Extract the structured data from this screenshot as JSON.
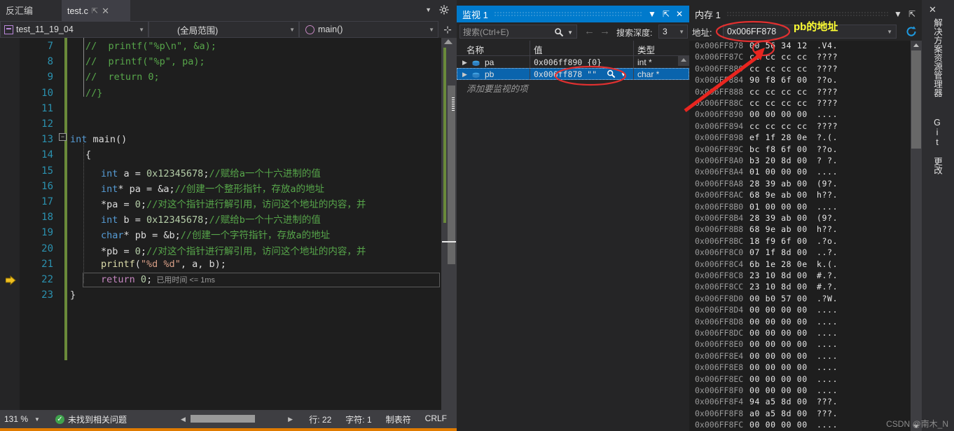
{
  "editor": {
    "tab_inactive_label": "反汇编",
    "tab_active_label": "test.c",
    "tab_pin_icon": "pin-icon",
    "tab_close_icon": "close-icon",
    "nav": {
      "project": "test_11_19_04",
      "scope": "(全局范围)",
      "function": "main()"
    },
    "lines": [
      {
        "n": 7,
        "tokens": [
          {
            "t": "//  printf(\"%p\\n\", &a);",
            "c": "c-cmt"
          }
        ]
      },
      {
        "n": 8,
        "tokens": [
          {
            "t": "//  printf(\"%p\", pa);",
            "c": "c-cmt"
          }
        ]
      },
      {
        "n": 9,
        "tokens": [
          {
            "t": "//  return 0;",
            "c": "c-cmt"
          }
        ]
      },
      {
        "n": 10,
        "tokens": [
          {
            "t": "//}",
            "c": "c-cmt"
          }
        ]
      },
      {
        "n": 11,
        "tokens": []
      },
      {
        "n": 12,
        "tokens": []
      },
      {
        "n": 13,
        "tokens": [
          {
            "t": "int",
            "c": "c-type"
          },
          {
            "t": " ",
            "c": "c-pl"
          },
          {
            "t": "main",
            "c": "c-pl"
          },
          {
            "t": "()",
            "c": "c-pl"
          }
        ]
      },
      {
        "n": 14,
        "tokens": [
          {
            "t": "{",
            "c": "c-pl"
          }
        ]
      },
      {
        "n": 15,
        "tokens": [
          {
            "t": "int",
            "c": "c-type"
          },
          {
            "t": " a = ",
            "c": "c-pl"
          },
          {
            "t": "0x12345678",
            "c": "c-num"
          },
          {
            "t": ";",
            "c": "c-pl"
          },
          {
            "t": "//赋给a一个十六进制的值",
            "c": "c-cmt"
          }
        ]
      },
      {
        "n": 16,
        "tokens": [
          {
            "t": "int",
            "c": "c-type"
          },
          {
            "t": "* pa = &a;",
            "c": "c-pl"
          },
          {
            "t": "//创建一个整形指针，存放a的地址",
            "c": "c-cmt"
          }
        ]
      },
      {
        "n": 17,
        "tokens": [
          {
            "t": "*pa = ",
            "c": "c-pl"
          },
          {
            "t": "0",
            "c": "c-num"
          },
          {
            "t": ";",
            "c": "c-pl"
          },
          {
            "t": "//对这个指针进行解引用，访问这个地址的内容，并",
            "c": "c-cmt"
          }
        ]
      },
      {
        "n": 18,
        "tokens": [
          {
            "t": "int",
            "c": "c-type"
          },
          {
            "t": " b = ",
            "c": "c-pl"
          },
          {
            "t": "0x12345678",
            "c": "c-num"
          },
          {
            "t": ";",
            "c": "c-pl"
          },
          {
            "t": "//赋给b一个十六进制的值",
            "c": "c-cmt"
          }
        ]
      },
      {
        "n": 19,
        "tokens": [
          {
            "t": "char",
            "c": "c-type"
          },
          {
            "t": "* pb = &b;",
            "c": "c-pl"
          },
          {
            "t": "//创建一个字符指针，存放a的地址",
            "c": "c-cmt"
          }
        ]
      },
      {
        "n": 20,
        "tokens": [
          {
            "t": "*pb = ",
            "c": "c-pl"
          },
          {
            "t": "0",
            "c": "c-num"
          },
          {
            "t": ";",
            "c": "c-pl"
          },
          {
            "t": "//对这个指针进行解引用，访问这个地址的内容，并",
            "c": "c-cmt"
          }
        ]
      },
      {
        "n": 21,
        "tokens": [
          {
            "t": "printf",
            "c": "c-fn"
          },
          {
            "t": "(",
            "c": "c-pl"
          },
          {
            "t": "\"%d %d\"",
            "c": "c-str"
          },
          {
            "t": ", a, b);",
            "c": "c-pl"
          }
        ]
      },
      {
        "n": 22,
        "tokens": [
          {
            "t": "return",
            "c": "c-ret"
          },
          {
            "t": " ",
            "c": "c-pl"
          },
          {
            "t": "0",
            "c": "c-num"
          },
          {
            "t": ";",
            "c": "c-pl"
          }
        ]
      },
      {
        "n": 23,
        "tokens": [
          {
            "t": "}",
            "c": "c-pl"
          }
        ]
      }
    ],
    "current_line": 22,
    "elapsed_text": "已用时间 <= 1ms",
    "current_pointer_icon": "execution-pointer-arrow-icon"
  },
  "statusbar": {
    "zoom": "131 %",
    "issues_icon": "check-circle-icon",
    "issues": "未找到相关问题",
    "line_label": "行: 22",
    "char_label": "字符: 1",
    "tabs_label": "制表符",
    "eol_label": "CRLF"
  },
  "watch": {
    "title": "监视 1",
    "dropdown_icon": "chevron-down-icon",
    "pin_icon": "pin-icon",
    "close_icon": "close-icon",
    "search_placeholder": "搜索(Ctrl+E)",
    "search_icon": "magnifier-icon",
    "search_dropdown_icon": "chevron-down-icon",
    "prev_icon": "arrow-left-icon",
    "next_icon": "arrow-right-icon",
    "depth_label": "搜索深度:",
    "depth_value": "3",
    "columns": [
      "名称",
      "值",
      "类型"
    ],
    "rows": [
      {
        "name": "pa",
        "value": "0x006ff890 {0}",
        "type": "int *",
        "selected": false,
        "icon": "variable-icon"
      },
      {
        "name": "pb",
        "value": "0x006ff878 \"\"",
        "type": "char *",
        "selected": true,
        "icon": "variable-icon"
      }
    ],
    "add_item_text": "添加要监视的项"
  },
  "memory": {
    "title": "内存 1",
    "dropdown_icon": "chevron-down-icon",
    "pin_icon": "pin-icon",
    "address_label": "地址:",
    "address_value": "0x006FF878",
    "address_dropdown_icon": "chevron-down-icon",
    "refresh_icon": "refresh-icon",
    "rows": [
      {
        "addr": "0x006FF878",
        "hex": "00 56 34 12",
        "ascii": ".V4."
      },
      {
        "addr": "0x006FF87C",
        "hex": "cc cc cc cc",
        "ascii": "????"
      },
      {
        "addr": "0x006FF880",
        "hex": "cc cc cc cc",
        "ascii": "????"
      },
      {
        "addr": "0x006FF884",
        "hex": "90 f8 6f 00",
        "ascii": "??o."
      },
      {
        "addr": "0x006FF888",
        "hex": "cc cc cc cc",
        "ascii": "????"
      },
      {
        "addr": "0x006FF88C",
        "hex": "cc cc cc cc",
        "ascii": "????"
      },
      {
        "addr": "0x006FF890",
        "hex": "00 00 00 00",
        "ascii": "...."
      },
      {
        "addr": "0x006FF894",
        "hex": "cc cc cc cc",
        "ascii": "????"
      },
      {
        "addr": "0x006FF898",
        "hex": "ef 1f 28 0e",
        "ascii": "?.(."
      },
      {
        "addr": "0x006FF89C",
        "hex": "bc f8 6f 00",
        "ascii": "??o."
      },
      {
        "addr": "0x006FF8A0",
        "hex": "b3 20 8d 00",
        "ascii": "? ?."
      },
      {
        "addr": "0x006FF8A4",
        "hex": "01 00 00 00",
        "ascii": "...."
      },
      {
        "addr": "0x006FF8A8",
        "hex": "28 39 ab 00",
        "ascii": "(9?."
      },
      {
        "addr": "0x006FF8AC",
        "hex": "68 9e ab 00",
        "ascii": "h??."
      },
      {
        "addr": "0x006FF8B0",
        "hex": "01 00 00 00",
        "ascii": "...."
      },
      {
        "addr": "0x006FF8B4",
        "hex": "28 39 ab 00",
        "ascii": "(9?."
      },
      {
        "addr": "0x006FF8B8",
        "hex": "68 9e ab 00",
        "ascii": "h??."
      },
      {
        "addr": "0x006FF8BC",
        "hex": "18 f9 6f 00",
        "ascii": ".?o."
      },
      {
        "addr": "0x006FF8C0",
        "hex": "07 1f 8d 00",
        "ascii": "..?."
      },
      {
        "addr": "0x006FF8C4",
        "hex": "6b 1e 28 0e",
        "ascii": "k.(."
      },
      {
        "addr": "0x006FF8C8",
        "hex": "23 10 8d 00",
        "ascii": "#.?."
      },
      {
        "addr": "0x006FF8CC",
        "hex": "23 10 8d 00",
        "ascii": "#.?."
      },
      {
        "addr": "0x006FF8D0",
        "hex": "00 b0 57 00",
        "ascii": ".?W."
      },
      {
        "addr": "0x006FF8D4",
        "hex": "00 00 00 00",
        "ascii": "...."
      },
      {
        "addr": "0x006FF8D8",
        "hex": "00 00 00 00",
        "ascii": "...."
      },
      {
        "addr": "0x006FF8DC",
        "hex": "00 00 00 00",
        "ascii": "...."
      },
      {
        "addr": "0x006FF8E0",
        "hex": "00 00 00 00",
        "ascii": "...."
      },
      {
        "addr": "0x006FF8E4",
        "hex": "00 00 00 00",
        "ascii": "...."
      },
      {
        "addr": "0x006FF8E8",
        "hex": "00 00 00 00",
        "ascii": "...."
      },
      {
        "addr": "0x006FF8EC",
        "hex": "00 00 00 00",
        "ascii": "...."
      },
      {
        "addr": "0x006FF8F0",
        "hex": "00 00 00 00",
        "ascii": "...."
      },
      {
        "addr": "0x006FF8F4",
        "hex": "94 a5 8d 00",
        "ascii": "???."
      },
      {
        "addr": "0x006FF8F8",
        "hex": "a0 a5 8d 00",
        "ascii": "???."
      },
      {
        "addr": "0x006FF8FC",
        "hex": "00 00 00 00",
        "ascii": "...."
      }
    ]
  },
  "right_rail": {
    "close_icon": "close-icon",
    "tabs": [
      "解决方案资源管理器",
      "Git 更改"
    ]
  },
  "annotations": {
    "pb_address_label": "pb的地址",
    "accent_red": "#e03030",
    "accent_yellow": "#ffff33"
  },
  "watermark": "CSDN @南木_N"
}
